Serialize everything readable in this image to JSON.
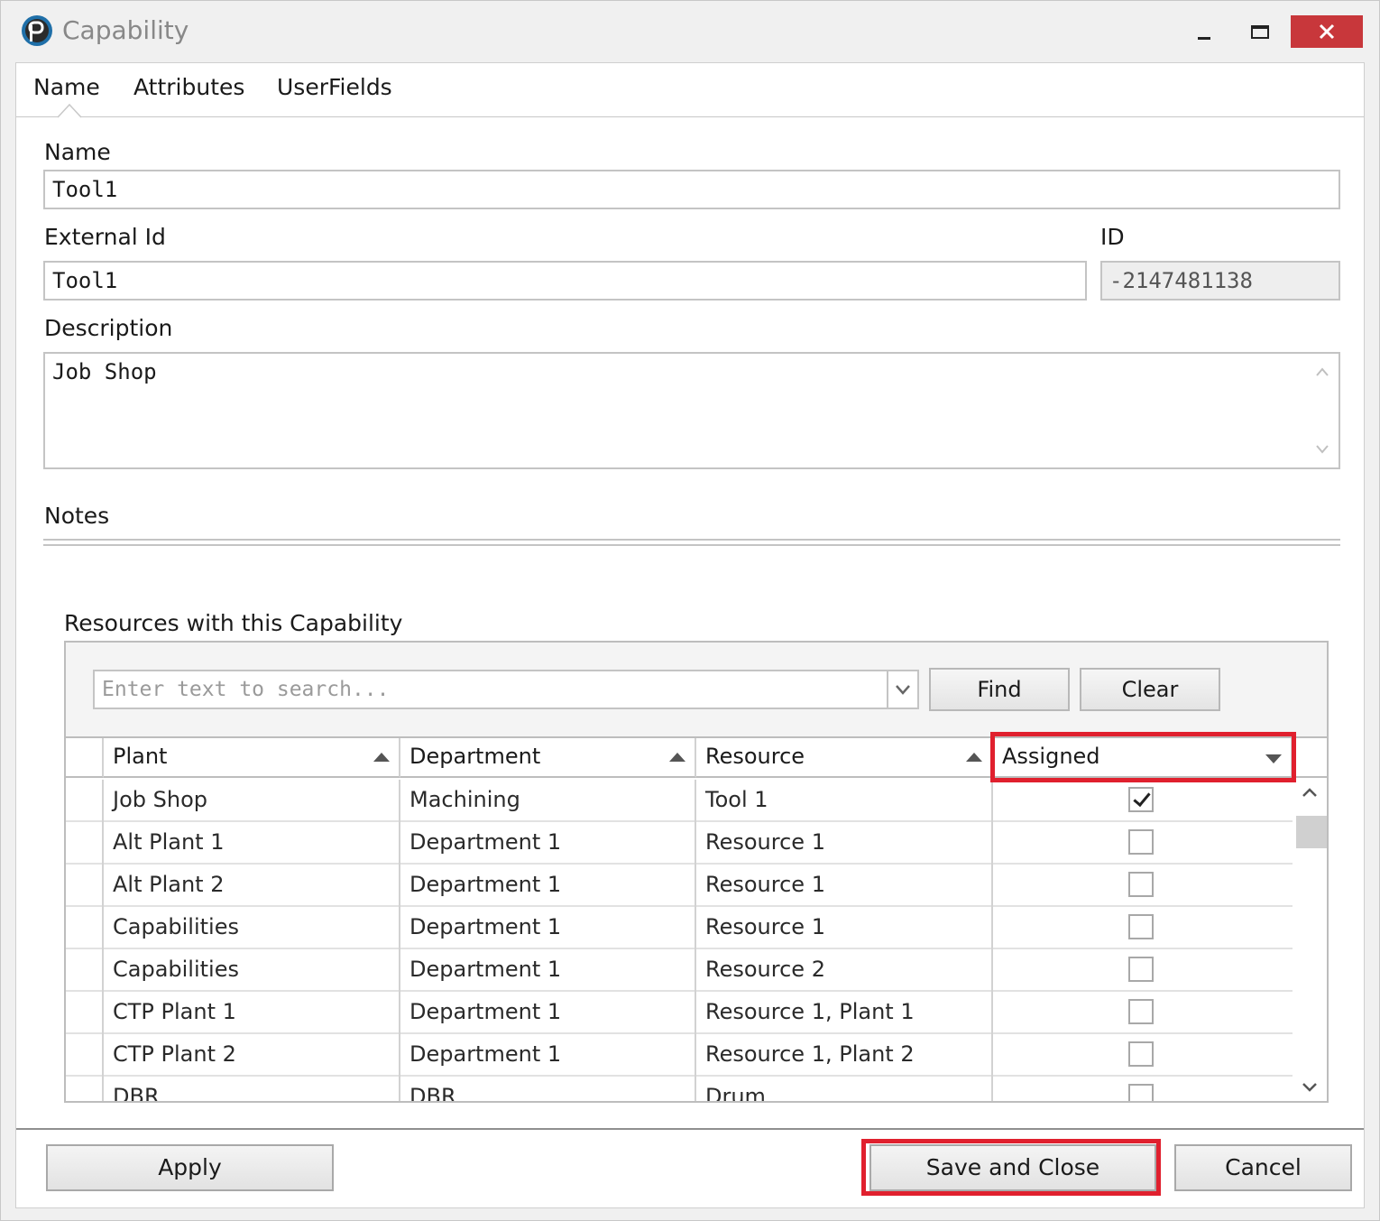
{
  "window": {
    "title": "Capability",
    "icons": {
      "app": "planettogether-logo-icon",
      "minimize": "minimize-icon",
      "maximize": "maximize-icon",
      "close": "close-icon"
    },
    "close_color": "#c8373b"
  },
  "tabs": [
    {
      "label": "Name",
      "active": true
    },
    {
      "label": "Attributes",
      "active": false
    },
    {
      "label": "UserFields",
      "active": false
    }
  ],
  "form": {
    "name_label": "Name",
    "name_value": "Tool1",
    "external_id_label": "External Id",
    "external_id_value": "Tool1",
    "id_label": "ID",
    "id_value": "-2147481138",
    "description_label": "Description",
    "description_value": "Job Shop",
    "notes_label": "Notes"
  },
  "resources": {
    "section_label": "Resources with this Capability",
    "search_placeholder": "Enter text to search...",
    "find_label": "Find",
    "clear_label": "Clear",
    "columns": [
      {
        "label": "Plant",
        "sort": "ascending"
      },
      {
        "label": "Department",
        "sort": "ascending"
      },
      {
        "label": "Resource",
        "sort": "ascending"
      },
      {
        "label": "Assigned",
        "sort": "descending"
      }
    ],
    "rows": [
      {
        "plant": "Job Shop",
        "department": "Machining",
        "resource": "Tool 1",
        "assigned": true
      },
      {
        "plant": "Alt Plant 1",
        "department": "Department 1",
        "resource": "Resource 1",
        "assigned": false
      },
      {
        "plant": "Alt Plant 2",
        "department": "Department 1",
        "resource": "Resource 1",
        "assigned": false
      },
      {
        "plant": "Capabilities",
        "department": "Department 1",
        "resource": "Resource 1",
        "assigned": false
      },
      {
        "plant": "Capabilities",
        "department": "Department 1",
        "resource": "Resource 2",
        "assigned": false
      },
      {
        "plant": "CTP Plant 1",
        "department": "Department 1",
        "resource": "Resource 1, Plant 1",
        "assigned": false
      },
      {
        "plant": "CTP Plant 2",
        "department": "Department 1",
        "resource": "Resource 1, Plant 2",
        "assigned": false
      },
      {
        "plant": "DBR",
        "department": "DBR",
        "resource": "Drum",
        "assigned": false
      }
    ]
  },
  "footer": {
    "apply_label": "Apply",
    "save_close_label": "Save and Close",
    "cancel_label": "Cancel"
  },
  "highlight_color": "#e0202e"
}
